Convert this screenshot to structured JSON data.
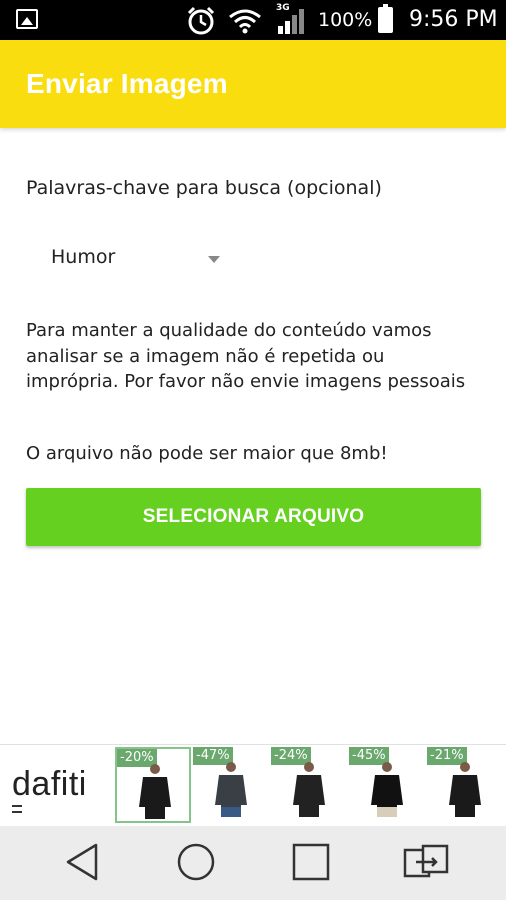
{
  "status_bar": {
    "network_type": "3G",
    "battery": "100%",
    "time": "9:56 PM"
  },
  "app_bar": {
    "title": "Enviar Imagem",
    "color": "#fadd0f"
  },
  "form": {
    "keywords_label": "Palavras-chave para busca (opcional)",
    "category_selected": "Humor",
    "info_text": "Para manter a qualidade do conteúdo vamos analisar se a imagem não é repetida ou imprópria. Por favor não envie imagens pessoais",
    "size_text": "O arquivo não pode ser maior que 8mb!",
    "select_button": "SELECIONAR ARQUIVO",
    "button_color": "#66d021"
  },
  "ad": {
    "brand": "dafiti",
    "products": [
      {
        "discount": "-20%",
        "selected": true
      },
      {
        "discount": "-47%",
        "selected": false
      },
      {
        "discount": "-24%",
        "selected": false
      },
      {
        "discount": "-45%",
        "selected": false
      },
      {
        "discount": "-21%",
        "selected": false
      }
    ]
  },
  "icons": {
    "status": [
      "image-icon",
      "alarm-icon",
      "wifi-icon",
      "signal-icon",
      "battery-icon"
    ],
    "nav": [
      "back-icon",
      "home-icon",
      "recents-icon",
      "switch-icon"
    ]
  }
}
